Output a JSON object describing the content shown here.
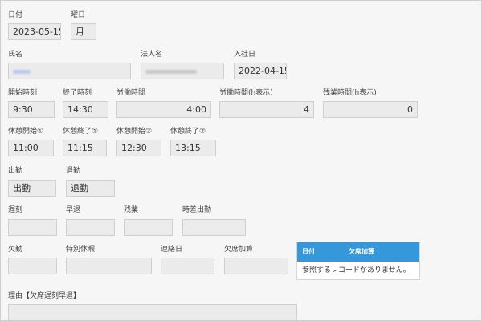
{
  "fields": {
    "date": {
      "label": "日付",
      "value": "2023-05-15"
    },
    "weekday": {
      "label": "曜日",
      "value": "月"
    },
    "name": {
      "label": "氏名",
      "value": ""
    },
    "corp": {
      "label": "法人名",
      "value": ""
    },
    "hire_date": {
      "label": "入社日",
      "value": "2022-04-15"
    },
    "start_time": {
      "label": "開始時刻",
      "value": "9:30"
    },
    "end_time": {
      "label": "終了時刻",
      "value": "14:30"
    },
    "work_time": {
      "label": "労働時間",
      "value": "4:00"
    },
    "work_hours": {
      "label": "労働時間(h表示)",
      "value": "4"
    },
    "overtime_hours": {
      "label": "残業時間(h表示)",
      "value": "0"
    },
    "break_start_1": {
      "label": "休憩開始①",
      "value": "11:00"
    },
    "break_end_1": {
      "label": "休憩終了①",
      "value": "11:15"
    },
    "break_start_2": {
      "label": "休憩開始②",
      "value": "12:30"
    },
    "break_end_2": {
      "label": "休憩終了②",
      "value": "13:15"
    },
    "clock_in": {
      "label": "出勤",
      "value": "出勤"
    },
    "clock_out": {
      "label": "退勤",
      "value": "退勤"
    },
    "late": {
      "label": "遅刻",
      "value": ""
    },
    "early_leave": {
      "label": "早退",
      "value": ""
    },
    "overtime": {
      "label": "残業",
      "value": ""
    },
    "staggered": {
      "label": "時差出勤",
      "value": ""
    },
    "absence": {
      "label": "欠勤",
      "value": ""
    },
    "special_leave": {
      "label": "特別休暇",
      "value": ""
    },
    "contact_date": {
      "label": "連絡日",
      "value": ""
    },
    "absence_bonus": {
      "label": "欠席加算",
      "value": ""
    },
    "reason": {
      "label": "理由【欠席遅刻早退】",
      "value": ""
    }
  },
  "related_table": {
    "columns": [
      "日付",
      "欠席加算"
    ],
    "empty_message": "参照するレコードがありません。"
  },
  "colors": {
    "accent": "#3498db",
    "field_bg": "#ebebeb"
  }
}
